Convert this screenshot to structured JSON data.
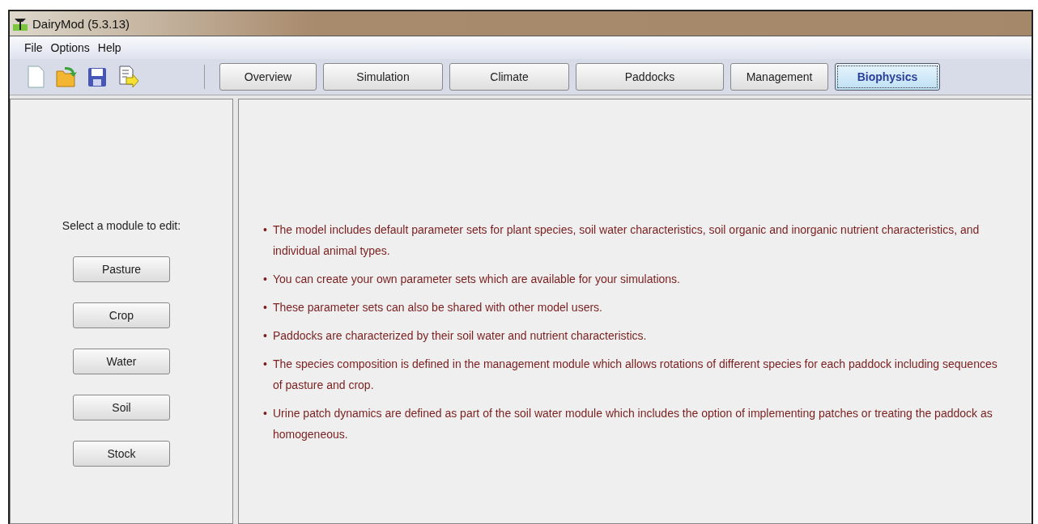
{
  "window": {
    "title": "DairyMod (5.3.13)"
  },
  "menu": [
    "File",
    "Options",
    "Help"
  ],
  "tabs": [
    {
      "label": "Overview",
      "selected": false
    },
    {
      "label": "Simulation",
      "selected": false
    },
    {
      "label": "Climate",
      "selected": false
    },
    {
      "label": "Paddocks",
      "selected": false
    },
    {
      "label": "Management",
      "selected": false
    },
    {
      "label": "Biophysics",
      "selected": true
    }
  ],
  "sidebar": {
    "prompt": "Select a module to edit:",
    "buttons": [
      "Pasture",
      "Crop",
      "Water",
      "Soil",
      "Stock"
    ]
  },
  "info": {
    "bullet": "•",
    "items": [
      "The model includes default parameter sets for plant species, soil water characteristics, soil organic and inorganic nutrient characteristics, and individual animal types.",
      "You can create your own parameter sets which are available for your simulations.",
      "These parameter sets can also be shared with other model users.",
      "Paddocks are characterized by their soil water and nutrient characteristics.",
      "The species composition is defined in the management module which allows rotations of different species for each paddock including sequences of pasture and crop.",
      "Urine patch dynamics are defined as part of the soil water module which includes the option of implementing patches or treating the paddock as homogeneous."
    ]
  }
}
